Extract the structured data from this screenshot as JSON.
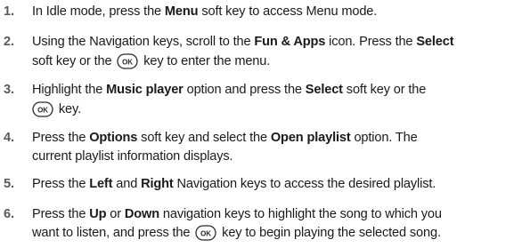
{
  "ok_key_label": "OK",
  "steps": [
    {
      "num": "1.",
      "p": [
        "In Idle mode, press the ",
        "Menu",
        " soft key to access Menu mode."
      ]
    },
    {
      "num": "2.",
      "line1": [
        "Using the Navigation keys, scroll to the ",
        "Fun & Apps",
        " icon. Press the ",
        "Select"
      ],
      "line2": [
        "soft key or the ",
        " key to enter the menu."
      ]
    },
    {
      "num": "3.",
      "line1": [
        "Highlight the ",
        "Music player",
        " option and press the ",
        "Select",
        " soft key or the"
      ],
      "line2": [
        " key."
      ]
    },
    {
      "num": "4.",
      "line1": [
        "Press the ",
        "Options",
        " soft key and select the ",
        "Open playlist",
        " option. The"
      ],
      "line2": [
        "current playlist information displays."
      ]
    },
    {
      "num": "5.",
      "p": [
        "Press the ",
        "Left",
        " and ",
        "Right",
        " Navigation keys to access the desired playlist."
      ]
    },
    {
      "num": "6.",
      "line1": [
        "Press the ",
        "Up",
        " or ",
        "Down",
        " navigation keys to highlight the song to which you"
      ],
      "line2": [
        "want to listen, and press the ",
        " key to begin playing the selected song."
      ]
    }
  ]
}
